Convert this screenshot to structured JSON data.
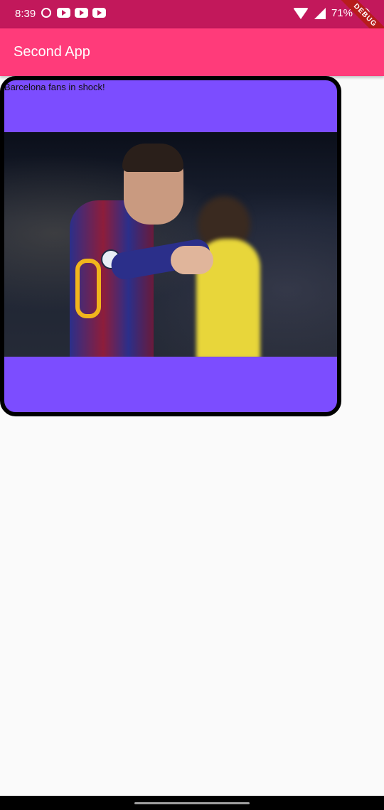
{
  "status_bar": {
    "time": "8:39",
    "battery": "71%",
    "debug_banner": "DEBUG",
    "left_icons": [
      "whatsapp-icon",
      "youtube-icon",
      "youtube-icon",
      "youtube-icon"
    ],
    "right_icons": [
      "wifi-icon",
      "signal-icon",
      "battery-icon"
    ],
    "color": "#c2185b"
  },
  "app_bar": {
    "title": "Second App",
    "color": "#ff3b7a"
  },
  "card": {
    "caption": "Barcelona fans in shock!",
    "background_color": "#7c4dff",
    "border_color": "#000000"
  },
  "nav_bar": {
    "color": "#000000"
  }
}
